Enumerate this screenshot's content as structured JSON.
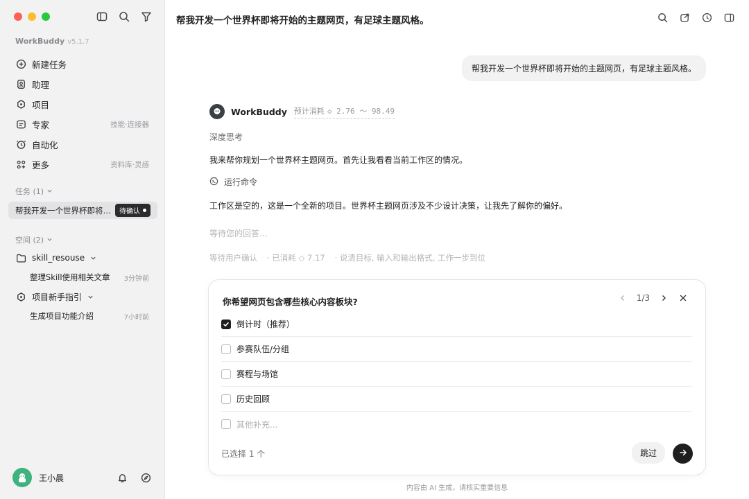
{
  "sidebar": {
    "brand": "WorkBuddy",
    "version": "v5.1.7",
    "nav": [
      {
        "label": "新建任务",
        "icon": "plus-circle-icon",
        "hint": ""
      },
      {
        "label": "助理",
        "icon": "assistant-icon",
        "hint": ""
      },
      {
        "label": "项目",
        "icon": "project-icon",
        "hint": ""
      },
      {
        "label": "专家",
        "icon": "expert-icon",
        "hint": "技能·连接器"
      },
      {
        "label": "自动化",
        "icon": "automation-icon",
        "hint": ""
      },
      {
        "label": "更多",
        "icon": "more-grid-icon",
        "hint": "资料库·灵感"
      }
    ],
    "tasks_title": "任务 (1)",
    "task": {
      "label": "帮我开发一个世界杯即将开始的主题网页，有足球主题风格。",
      "badge": "待确认"
    },
    "space_title": "空间 (2)",
    "spaces": [
      {
        "folder": "skill_resouse",
        "file": "整理Skill使用相关文章",
        "time": "3分钟前"
      },
      {
        "folder": "项目新手指引",
        "file": "生成项目功能介绍",
        "time": "7小时前"
      }
    ],
    "user_name": "王小晨"
  },
  "main": {
    "title": "帮我开发一个世界杯即将开始的主题网页，有足球主题风格。",
    "user_message": "帮我开发一个世界杯即将开始的主题网页，有足球主题风格。",
    "bot_name": "WorkBuddy",
    "cost_label": "预计消耗",
    "cost_value": "◇ 2.76 ～ 98.49",
    "thinking": "深度思考",
    "reply1": "我来帮你规划一个世界杯主题网页。首先让我看看当前工作区的情况。",
    "run_command": "运行命令",
    "reply2": "工作区是空的，这是一个全新的项目。世界杯主题网页涉及不少设计决策，让我先了解你的偏好。",
    "waiting": "等待您的回答...",
    "status": [
      "等待用户确认",
      "· 已消耗 ◇ 7.17",
      "· 说清目标, 输入和输出格式, 工作一步到位"
    ]
  },
  "card": {
    "question": "你希望网页包含哪些核心内容板块?",
    "page": "1/3",
    "options": [
      {
        "label": "倒计时（推荐）",
        "checked": true
      },
      {
        "label": "参赛队伍/分组",
        "checked": false
      },
      {
        "label": "赛程与场馆",
        "checked": false
      },
      {
        "label": "历史回顾",
        "checked": false
      }
    ],
    "other_placeholder": "其他补充...",
    "selected": "已选择 1 个",
    "skip": "跳过"
  },
  "footer": "内容由 AI 生成，请核实重要信息"
}
